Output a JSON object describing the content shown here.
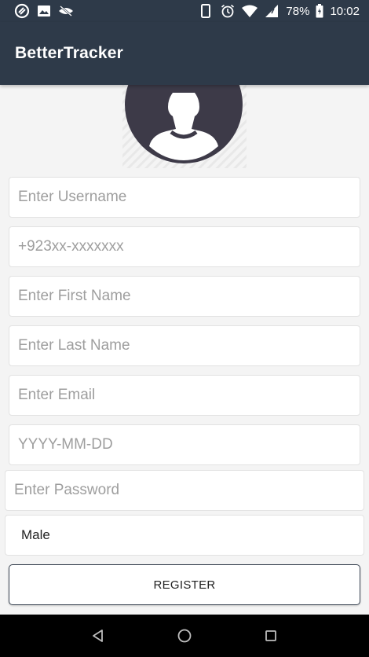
{
  "status_bar": {
    "icons_left": [
      "sync-icon",
      "image-icon",
      "visibility-off-icon"
    ],
    "icons_right": [
      "phone-icon",
      "alarm-icon",
      "wifi-icon",
      "signal-icon",
      "battery-icon"
    ],
    "battery": "78%",
    "time": "10:02"
  },
  "app_bar": {
    "title": "BetterTracker",
    "color": "#2e3a49"
  },
  "form": {
    "username_placeholder": "Enter Username",
    "phone_placeholder": "+923xx-xxxxxxx",
    "first_name_placeholder": "Enter First Name",
    "last_name_placeholder": "Enter Last Name",
    "email_placeholder": "Enter Email",
    "dob_placeholder": "YYYY-MM-DD",
    "password_placeholder": "Enter Password",
    "gender_value": "Male",
    "register_label": "REGISTER"
  },
  "nav_bar": {
    "buttons": [
      "back-icon",
      "home-icon",
      "recents-icon"
    ]
  }
}
